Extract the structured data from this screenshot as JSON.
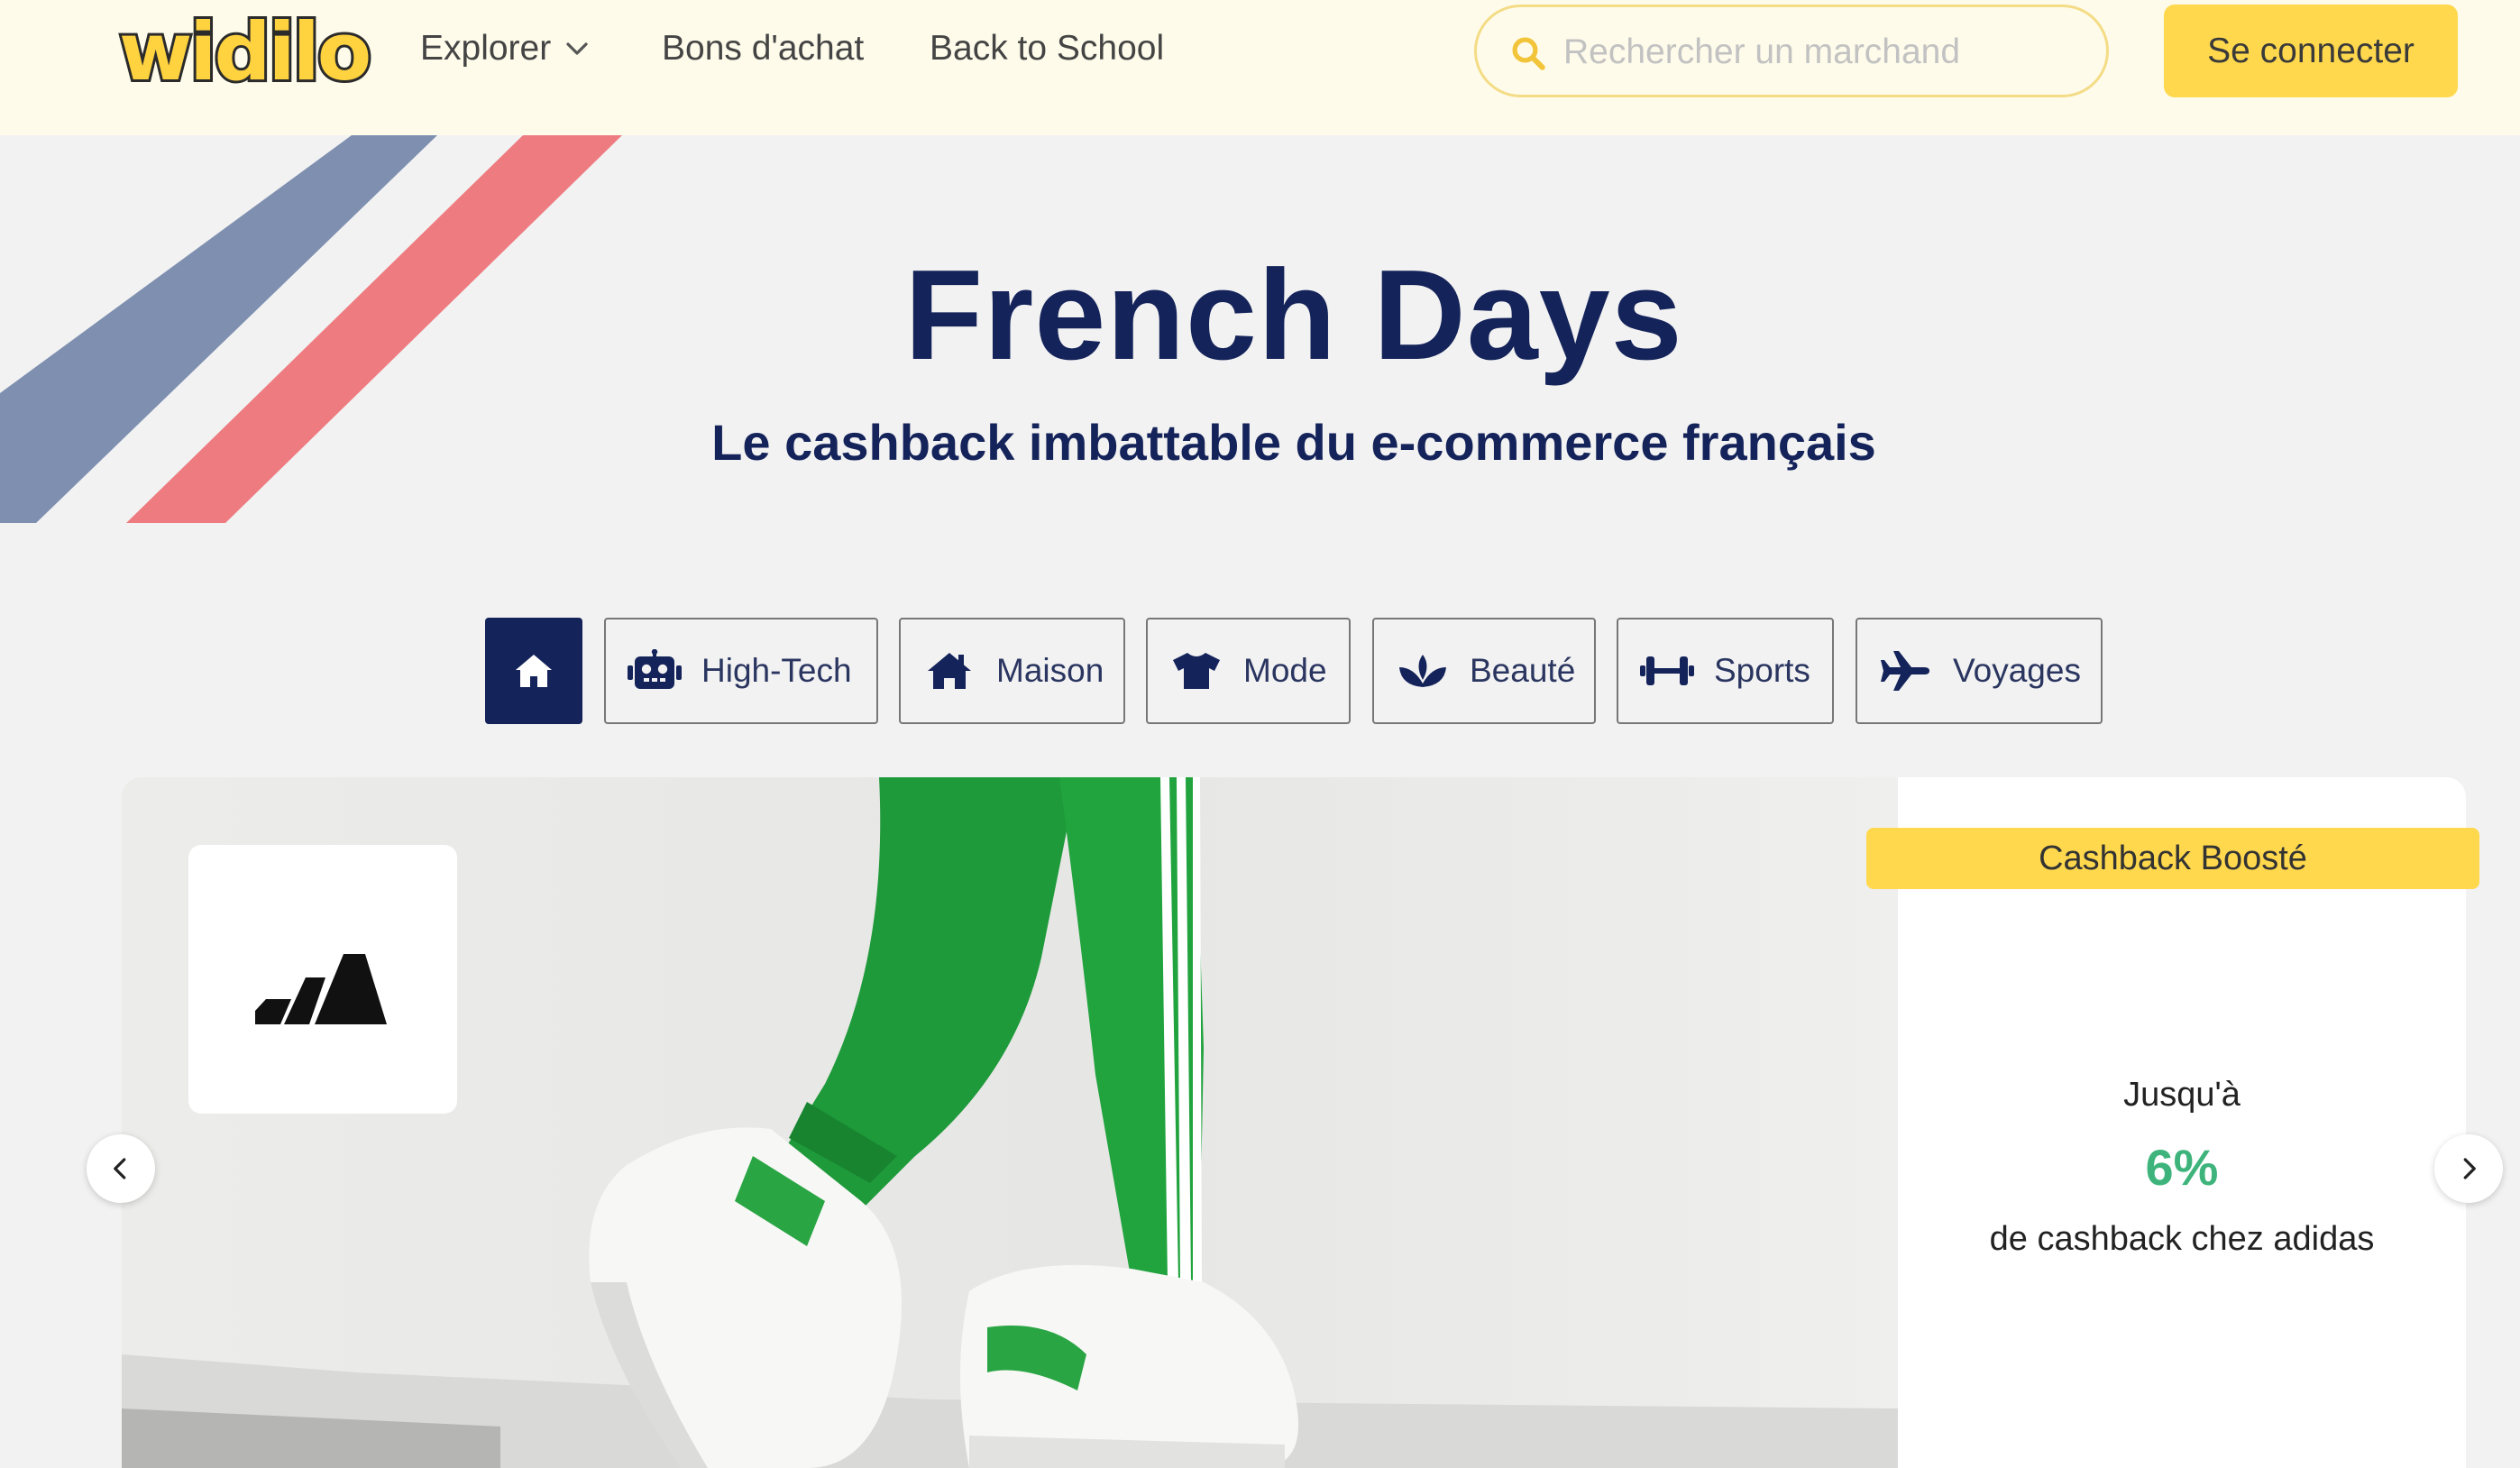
{
  "header": {
    "logo_text": "widilo",
    "nav": {
      "explorer": "Explorer",
      "bons": "Bons d'achat",
      "school": "Back to School"
    },
    "search_placeholder": "Rechercher un marchand",
    "login_label": "Se connecter"
  },
  "hero": {
    "title": "French Days",
    "subtitle": "Le cashback imbattable du e-commerce français"
  },
  "categories": {
    "home": {
      "icon": "home-icon",
      "active": true
    },
    "items": [
      {
        "label": "High-Tech",
        "icon": "robot-icon"
      },
      {
        "label": "Maison",
        "icon": "house-icon"
      },
      {
        "label": "Mode",
        "icon": "tshirt-icon"
      },
      {
        "label": "Beauté",
        "icon": "lotus-icon"
      },
      {
        "label": "Sports",
        "icon": "dumbbell-icon"
      },
      {
        "label": "Voyages",
        "icon": "plane-icon"
      }
    ]
  },
  "carousel": {
    "brand_logo": "adidas-logo",
    "badge": "Cashback Boosté",
    "upto": "Jusqu'à",
    "percent": "6%",
    "description": "de cashback chez adidas"
  },
  "colors": {
    "header_bg": "#fefbea",
    "accent_yellow": "#ffd84d",
    "navy": "#14235a",
    "stripe_blue": "#7e8fb0",
    "stripe_red": "#ee7b80",
    "cashback_green": "#3eb47c"
  }
}
